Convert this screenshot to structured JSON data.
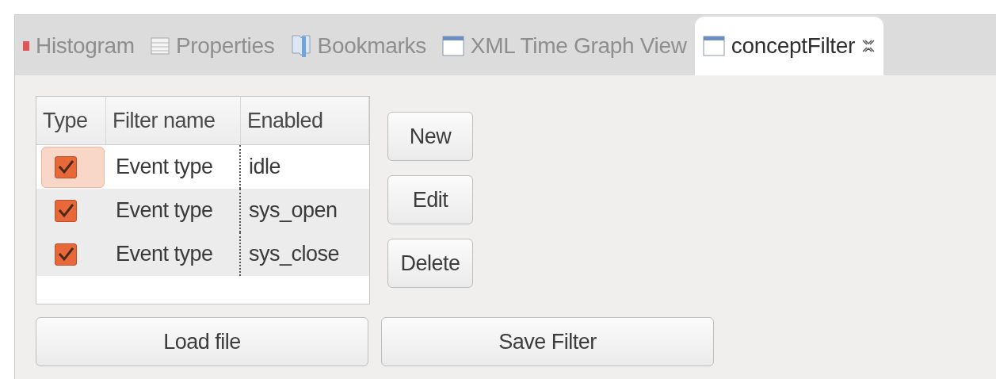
{
  "tabs": [
    {
      "label": "Histogram",
      "kind": "histogram",
      "selected": false
    },
    {
      "label": "Properties",
      "kind": "properties",
      "selected": false
    },
    {
      "label": "Bookmarks",
      "kind": "bookmarks",
      "selected": false
    },
    {
      "label": "XML Time Graph View",
      "kind": "window",
      "selected": false
    },
    {
      "label": "conceptFilter",
      "kind": "window",
      "selected": true
    }
  ],
  "table": {
    "columns": [
      "Type",
      "Filter name",
      "Enabled"
    ],
    "rows": [
      {
        "checked": true,
        "selected": true,
        "filter_name": "Event type",
        "enabled": "idle"
      },
      {
        "checked": true,
        "selected": false,
        "filter_name": "Event type",
        "enabled": "sys_open"
      },
      {
        "checked": true,
        "selected": false,
        "filter_name": "Event type",
        "enabled": "sys_close"
      }
    ]
  },
  "side_buttons": [
    "New",
    "Edit",
    "Delete"
  ],
  "bottom_buttons": [
    "Load file",
    "Save Filter"
  ]
}
